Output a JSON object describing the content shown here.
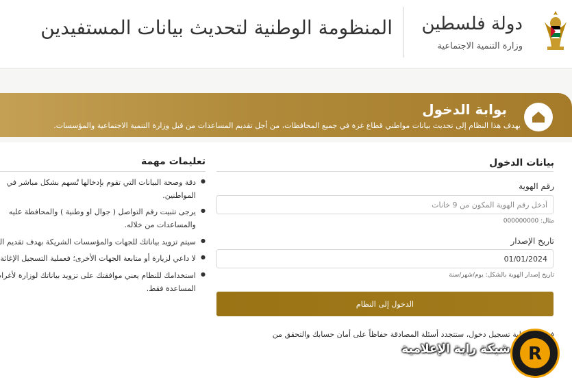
{
  "header": {
    "state_name": "دولة فلسطين",
    "ministry_name": "وزارة التنمية الاجتماعية",
    "system_title": "المنظومة الوطنية لتحديث بيانات المستفيدين"
  },
  "banner": {
    "title": "بوابة الدخول",
    "description": "يهدف هذا النظام إلى تحديث بيانات مواطني قطاع غزة في جميع المحافظات، من أجل تقديم المساعدات من قبل وزارة التنمية الاجتماعية والمؤسسات."
  },
  "login": {
    "section_title": "بيانات الدخول",
    "id_label": "رقم الهوية",
    "id_placeholder": "أدخل رقم الهوية المكون من 9 خانات",
    "id_hint": "مثال: 000000000",
    "date_label": "تاريخ الإصدار",
    "date_value": "01/01/2024",
    "date_hint": "تاريخ إصدار الهوية بالشكل: يوم/شهر/سنة",
    "submit_label": "الدخول إلى النظام",
    "security_note": "في كل عملية تسجيل دخول، ستتجدد أسئلة المصادقة حفاظاً على أمان حسابك والتحقق من"
  },
  "instructions": {
    "title": "تعليمات مهمة",
    "items": [
      "دقة وصحة البيانات التي تقوم بإدخالها تُسهم بشكل مباشر في المواطنين.",
      "يرجى تثبيت رقم التواصل ( جوال او وطنية ) والمحافظة عليه والمساعدات من خلاله.",
      "سيتم تزويد بياناتك للجهات والمؤسسات الشريكة بهدف تقديم اللازمة.",
      "لا داعي لزيارة أو متابعة الجهات الأخرى؛ فعملية التسجيل الإغاثة.",
      "استخدامك للنظام يعني موافقتك على تزويد بياناتك لوزارة لأغراض المساعدة فقط."
    ]
  },
  "watermark": {
    "text": "شبكة راية الإعلامية",
    "letter": "R"
  },
  "colors": {
    "gold": "#a57b2a",
    "button": "#9a7315",
    "watermark_ring": "#f0a000"
  }
}
